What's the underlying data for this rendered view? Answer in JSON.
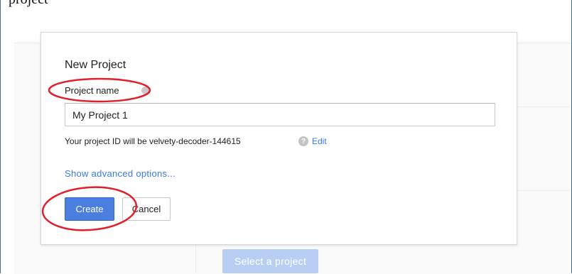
{
  "header": {
    "caption": "project"
  },
  "background": {
    "select_project_label": "Select a project"
  },
  "dialog": {
    "title": "New Project",
    "field_label": "Project name",
    "input_value": "My Project 1",
    "project_id_text": "Your project ID will be velvety-decoder-144615",
    "help_glyph": "?",
    "edit_label": "Edit",
    "advanced_label": "Show advanced options...",
    "create_label": "Create",
    "cancel_label": "Cancel"
  },
  "colors": {
    "primary_button": "#4a7fe0",
    "link": "#3b78e7",
    "annotation_circle": "#e0202a",
    "disabled_button": "#b8cff3"
  },
  "icons": {
    "field_help": "help-dot-icon",
    "project_id_help": "question-circle-icon"
  }
}
